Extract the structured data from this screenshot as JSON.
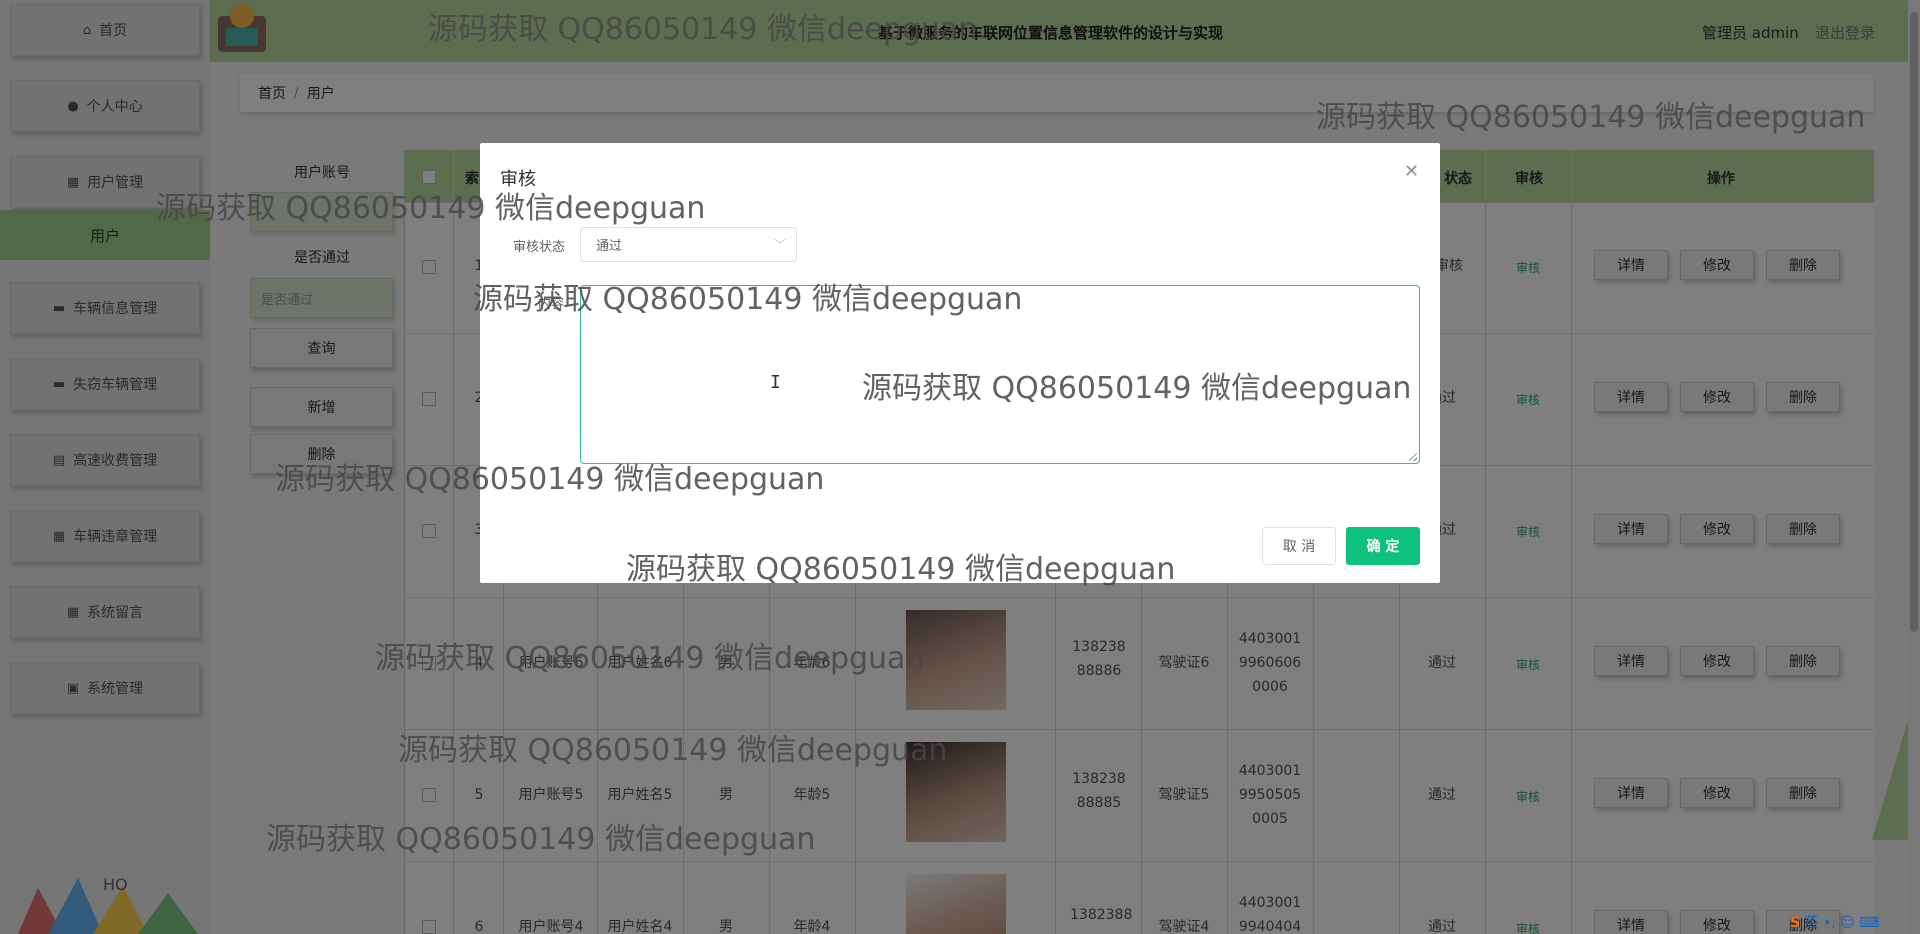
{
  "header": {
    "app_title": "基于微服务的车联网位置信息管理软件的设计与实现",
    "admin_label": "管理员 admin",
    "logout_label": "退出登录"
  },
  "sidebar": {
    "items": [
      {
        "label": "首页",
        "icon": "home-icon"
      },
      {
        "label": "个人中心",
        "icon": "user-icon"
      },
      {
        "label": "用户管理",
        "icon": "grid-icon"
      },
      {
        "label": "车辆信息管理",
        "icon": "card-icon"
      },
      {
        "label": "失窃车辆管理",
        "icon": "card-icon"
      },
      {
        "label": "高速收费管理",
        "icon": "printer-icon"
      },
      {
        "label": "车辆违章管理",
        "icon": "apps-icon"
      },
      {
        "label": "系统留言",
        "icon": "grid-icon"
      },
      {
        "label": "系统管理",
        "icon": "briefcase-icon"
      }
    ],
    "active_sub": "用户"
  },
  "breadcrumb": {
    "home": "首页",
    "sep": "/",
    "current": "用户"
  },
  "search": {
    "account_label": "用户账号",
    "pass_label": "是否通过",
    "pass_placeholder": "是否通过",
    "query_btn": "查询",
    "add_btn": "新增",
    "delete_btn": "删除"
  },
  "table": {
    "headers": {
      "index": "索",
      "status": "状态",
      "audit": "审核",
      "ops": "操作"
    },
    "rows": [
      {
        "idx": "1",
        "status": "待审核",
        "audit": "审核"
      },
      {
        "idx": "2",
        "status": "通过",
        "audit": "审核"
      },
      {
        "idx": "3",
        "status": "通过",
        "audit": "审核"
      },
      {
        "idx": "4",
        "account": "用户账号6",
        "name": "用户姓名6",
        "gender": "男",
        "age": "年龄6",
        "phone": "13823888886",
        "license": "驾驶证6",
        "idcard": "440300199606060006",
        "status": "通过",
        "audit": "审核"
      },
      {
        "idx": "5",
        "account": "用户账号5",
        "name": "用户姓名5",
        "gender": "男",
        "age": "年龄5",
        "phone": "13823888885",
        "license": "驾驶证5",
        "idcard": "440300199505050005",
        "status": "通过",
        "audit": "审核"
      },
      {
        "idx": "6",
        "account": "用户账号4",
        "name": "用户姓名4",
        "gender": "男",
        "age": "年龄4",
        "phone": "1382388",
        "license": "驾驶证4",
        "idcard": "44030019940404",
        "status": "通过",
        "audit": "审核"
      }
    ],
    "actions": {
      "detail": "详情",
      "edit": "修改",
      "delete": "删除"
    }
  },
  "modal": {
    "title": "审核",
    "status_label": "审核状态",
    "status_value": "通过",
    "content_label": "内容",
    "textarea_value": "",
    "cancel": "取 消",
    "confirm": "确 定"
  },
  "watermark": "源码获取 QQ86050149 微信deepguan",
  "ime": {
    "lang": "英",
    "extra": "•, ☺ ⌨"
  }
}
